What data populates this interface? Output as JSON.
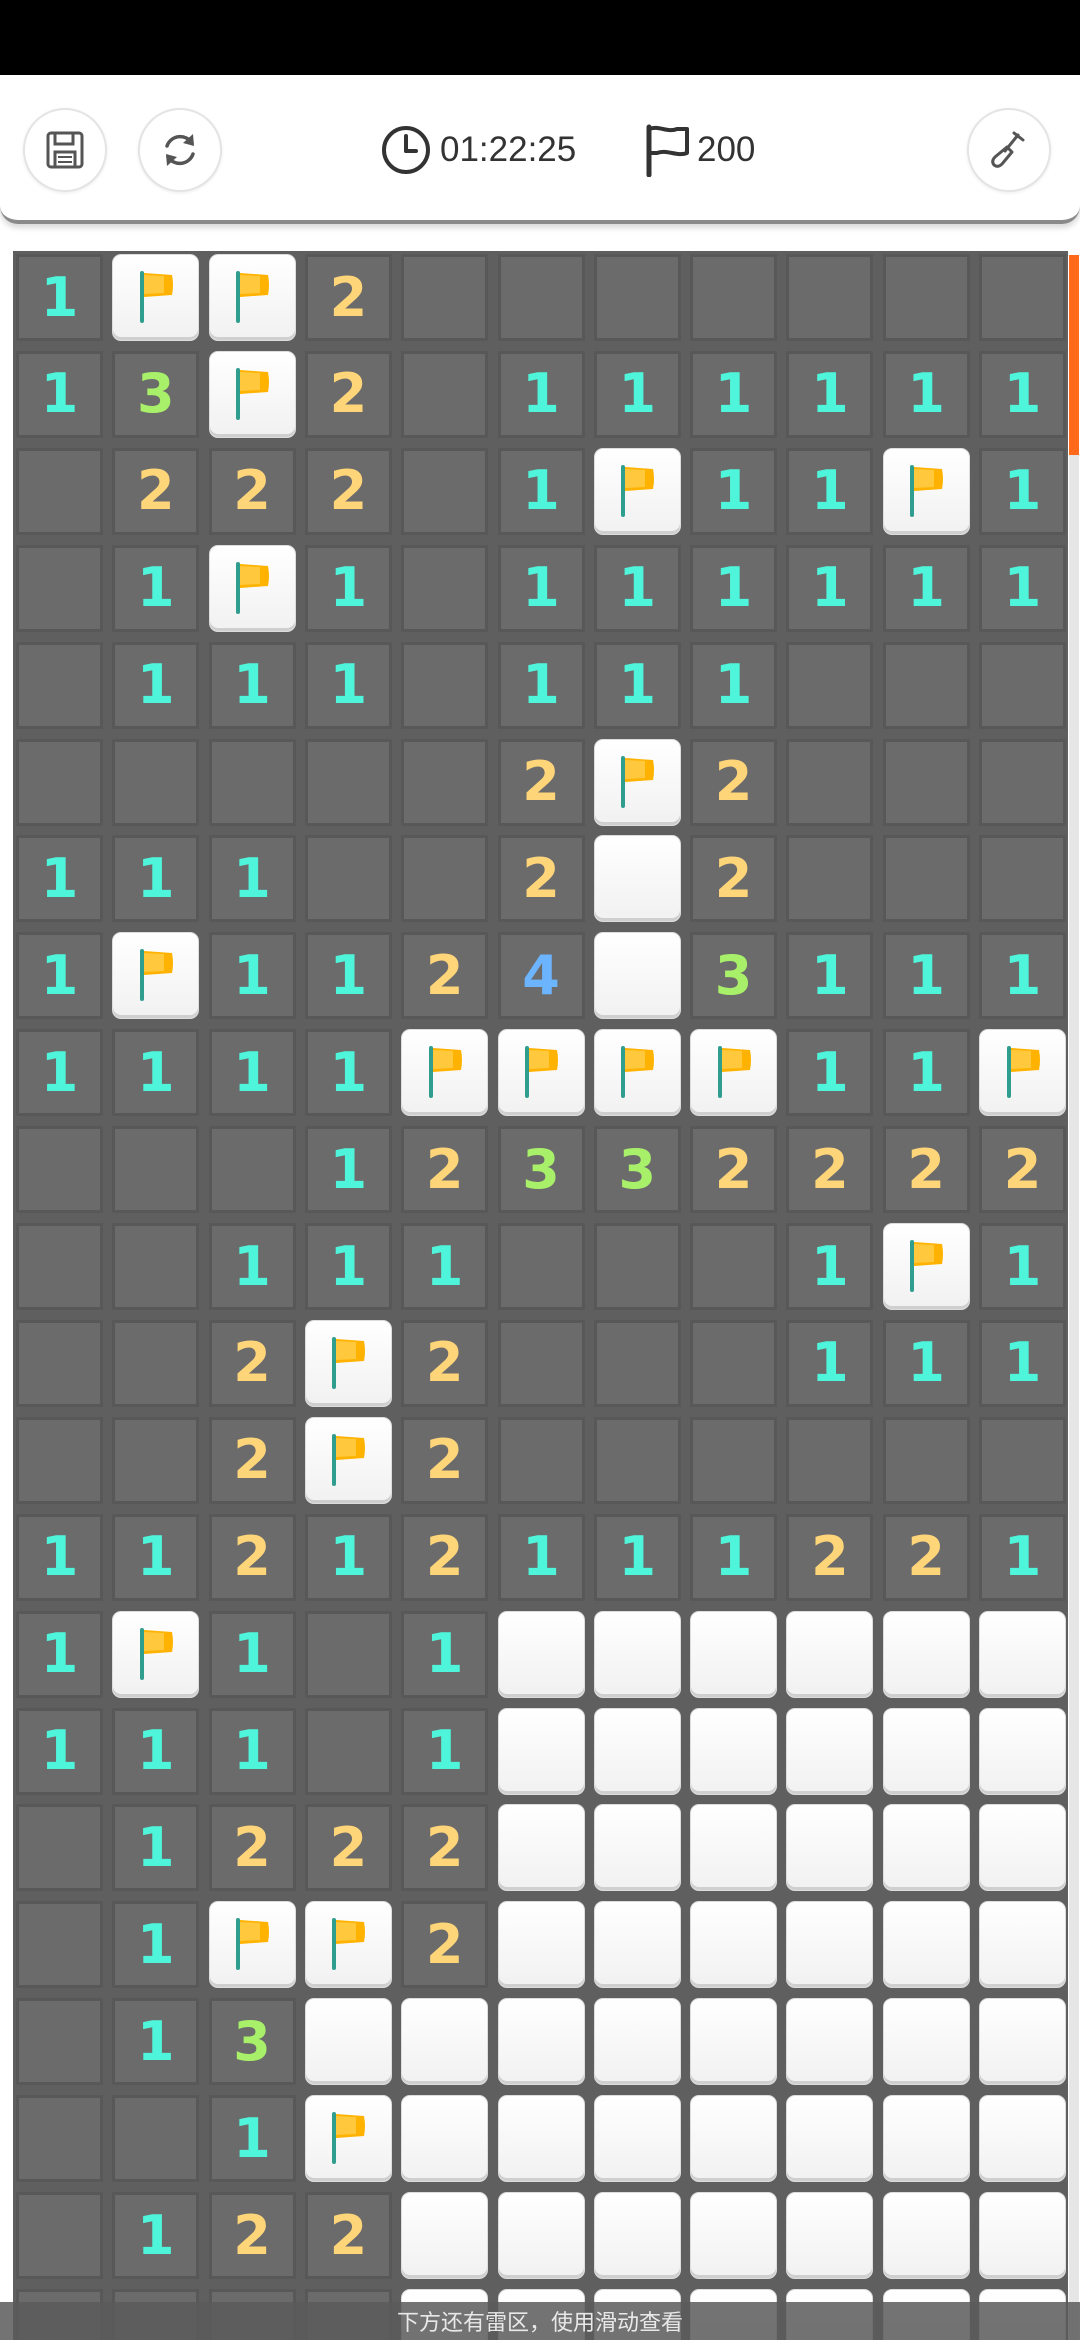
{
  "toolbar": {
    "save_icon": "save-icon",
    "restart_icon": "refresh-icon",
    "timer_icon": "clock-icon",
    "timer_value": "01:22:25",
    "flag_icon": "flag-outline-icon",
    "flag_count": "200",
    "dig_icon": "shovel-icon"
  },
  "board": {
    "legend": "H = unrevealed, W = revealed blank white tile, F = flagged, . = opened empty, digits = adjacent mine count",
    "rows": [
      [
        "1",
        "F",
        "F",
        "2",
        "H",
        "H",
        "H",
        "H",
        "H",
        "H",
        "H"
      ],
      [
        "1",
        "3",
        "F",
        "2",
        ".",
        "1",
        "1",
        "1",
        "1",
        "1",
        "1"
      ],
      [
        ".",
        "2",
        "2",
        "2",
        ".",
        "1",
        "F",
        "1",
        "1",
        "F",
        "1"
      ],
      [
        ".",
        "1",
        "F",
        "1",
        ".",
        "1",
        "1",
        "1",
        "1",
        "1",
        "1"
      ],
      [
        ".",
        "1",
        "1",
        "1",
        ".",
        "1",
        "1",
        "1",
        ".",
        ".",
        "."
      ],
      [
        ".",
        ".",
        ".",
        ".",
        ".",
        "2",
        "F",
        "2",
        ".",
        ".",
        "."
      ],
      [
        "1",
        "1",
        "1",
        ".",
        ".",
        "2",
        "W",
        "2",
        ".",
        ".",
        "."
      ],
      [
        "1",
        "F",
        "1",
        "1",
        "2",
        "4",
        "W",
        "3",
        "1",
        "1",
        "1"
      ],
      [
        "1",
        "1",
        "1",
        "1",
        "F",
        "F",
        "F",
        "F",
        "1",
        "1",
        "F"
      ],
      [
        ".",
        ".",
        ".",
        "1",
        "2",
        "3",
        "3",
        "2",
        "2",
        "2",
        "2"
      ],
      [
        ".",
        ".",
        "1",
        "1",
        "1",
        ".",
        ".",
        ".",
        "1",
        "F",
        "1"
      ],
      [
        ".",
        ".",
        "2",
        "F",
        "2",
        ".",
        ".",
        ".",
        "1",
        "1",
        "1"
      ],
      [
        ".",
        ".",
        "2",
        "F",
        "2",
        ".",
        ".",
        ".",
        ".",
        ".",
        "."
      ],
      [
        "1",
        "1",
        "2",
        "1",
        "2",
        "1",
        "1",
        "1",
        "2",
        "2",
        "1"
      ],
      [
        "1",
        "F",
        "1",
        ".",
        "1",
        "W",
        "W",
        "W",
        "W",
        "W",
        "W"
      ],
      [
        "1",
        "1",
        "1",
        ".",
        "1",
        "W",
        "W",
        "W",
        "W",
        "W",
        "W"
      ],
      [
        ".",
        "1",
        "2",
        "2",
        "2",
        "W",
        "W",
        "W",
        "W",
        "W",
        "W"
      ],
      [
        ".",
        "1",
        "F",
        "F",
        "2",
        "W",
        "W",
        "W",
        "W",
        "W",
        "W"
      ],
      [
        ".",
        "1",
        "3",
        "W",
        "W",
        "W",
        "W",
        "W",
        "W",
        "W",
        "W"
      ],
      [
        ".",
        ".",
        "1",
        "F",
        "W",
        "W",
        "W",
        "W",
        "W",
        "W",
        "W"
      ],
      [
        ".",
        "1",
        "2",
        "2",
        "W",
        "W",
        "W",
        "W",
        "W",
        "W",
        "W"
      ],
      [
        ".",
        ".",
        ".",
        ".",
        "W",
        "W",
        "W",
        "W",
        "W",
        "W",
        "W"
      ]
    ]
  },
  "colors": {
    "one": "#4ff5da",
    "two": "#ffd57a",
    "three": "#a8f06a",
    "four": "#6db4ff",
    "flag": "#ffb300",
    "scroll_accent": "#ff6a1a"
  },
  "hint": "下方还有雷区，使用滑动查看"
}
